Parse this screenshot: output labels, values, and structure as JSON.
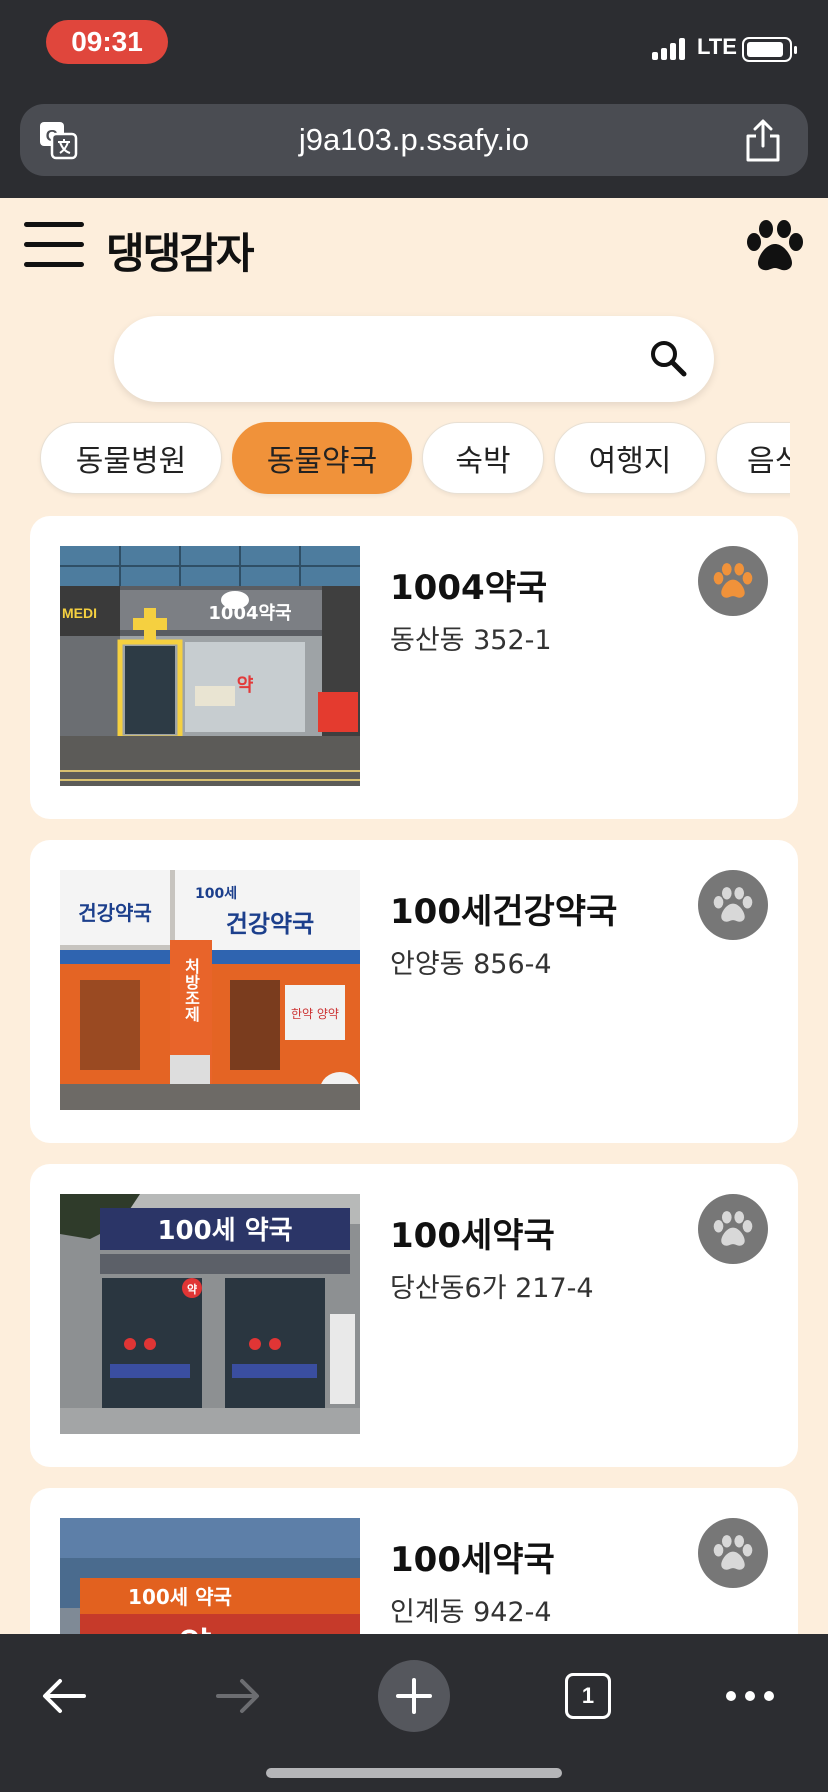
{
  "status_bar": {
    "time": "09:31",
    "network": "LTE"
  },
  "browser": {
    "url": "j9a103.p.ssafy.io"
  },
  "app": {
    "brand": "댕댕감자"
  },
  "search": {
    "placeholder": ""
  },
  "categories": [
    {
      "label": "동물병원",
      "active": false
    },
    {
      "label": "동물약국",
      "active": true
    },
    {
      "label": "숙박",
      "active": false
    },
    {
      "label": "여행지",
      "active": false
    },
    {
      "label": "음식점",
      "active": false
    }
  ],
  "places": [
    {
      "name": "1004약국",
      "address": "동산동 352-1",
      "favorite": true
    },
    {
      "name": "100세건강약국",
      "address": "안양동 856-4",
      "favorite": false
    },
    {
      "name": "100세약국",
      "address": "당산동6가 217-4",
      "favorite": false
    },
    {
      "name": "100세약국",
      "address": "인계동 942-4",
      "favorite": false
    }
  ],
  "photo_signs": {
    "p1_sign": "1004약국",
    "p1_medi": "MEDI",
    "p1_yak": "약",
    "p2_left": "건강약국",
    "p2_right_top": "100세",
    "p2_right": "건강약국",
    "p2_vertical": "처방조제",
    "p2_side": "한약 양약",
    "p3_sign": "100세 약국",
    "p3_badge": "약",
    "p4_sign": "100세 약국",
    "p4_big": "약"
  },
  "colors": {
    "accent": "#f0923a",
    "background": "#fdeedc",
    "browser_chrome": "#2c2d31",
    "fav_inactive": "#777777",
    "time_pill": "#e0463c"
  },
  "toolbar": {
    "tab_count": "1",
    "icons": [
      "back-arrow-icon",
      "forward-arrow-icon",
      "new-tab-plus-icon",
      "tabs-icon",
      "more-icon"
    ]
  }
}
